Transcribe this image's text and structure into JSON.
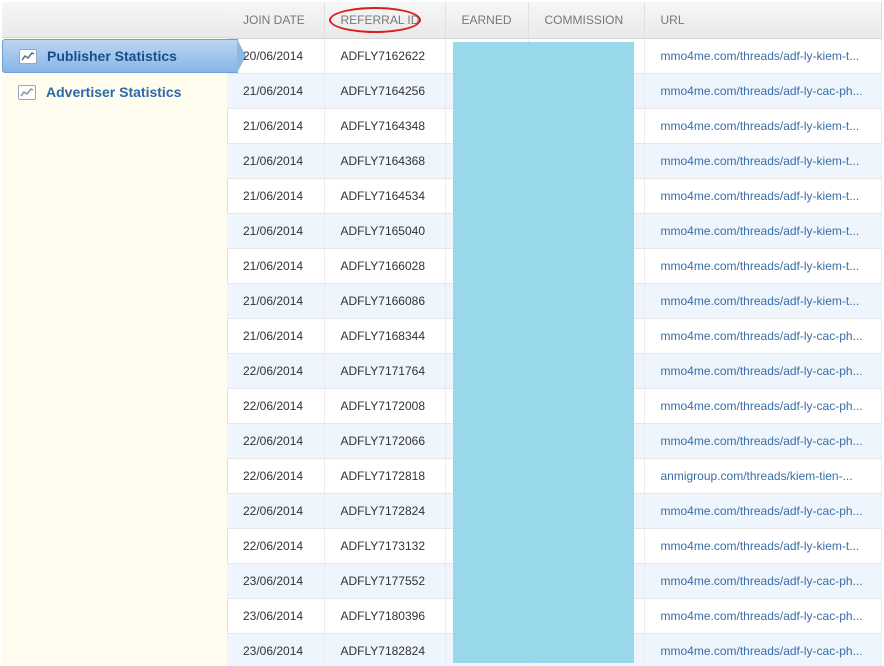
{
  "sidebar": {
    "items": [
      {
        "label": "Publisher Statistics",
        "icon": "chart-icon",
        "active": true
      },
      {
        "label": "Advertiser Statistics",
        "icon": "chart-icon",
        "active": false
      }
    ]
  },
  "table": {
    "headers": {
      "join_date": "JOIN DATE",
      "referral_id": "REFERRAL ID",
      "earned": "EARNED",
      "commission": "COMMISSION",
      "url": "URL"
    },
    "rows": [
      {
        "date": "20/06/2014",
        "id": "ADFLY7162622",
        "url": "mmo4me.com/threads/adf-ly-kiem-t..."
      },
      {
        "date": "21/06/2014",
        "id": "ADFLY7164256",
        "url": "mmo4me.com/threads/adf-ly-cac-ph..."
      },
      {
        "date": "21/06/2014",
        "id": "ADFLY7164348",
        "url": "mmo4me.com/threads/adf-ly-kiem-t..."
      },
      {
        "date": "21/06/2014",
        "id": "ADFLY7164368",
        "url": "mmo4me.com/threads/adf-ly-kiem-t..."
      },
      {
        "date": "21/06/2014",
        "id": "ADFLY7164534",
        "url": "mmo4me.com/threads/adf-ly-kiem-t..."
      },
      {
        "date": "21/06/2014",
        "id": "ADFLY7165040",
        "url": "mmo4me.com/threads/adf-ly-kiem-t..."
      },
      {
        "date": "21/06/2014",
        "id": "ADFLY7166028",
        "url": "mmo4me.com/threads/adf-ly-kiem-t..."
      },
      {
        "date": "21/06/2014",
        "id": "ADFLY7166086",
        "url": "mmo4me.com/threads/adf-ly-kiem-t..."
      },
      {
        "date": "21/06/2014",
        "id": "ADFLY7168344",
        "url": "mmo4me.com/threads/adf-ly-cac-ph..."
      },
      {
        "date": "22/06/2014",
        "id": "ADFLY7171764",
        "url": "mmo4me.com/threads/adf-ly-cac-ph..."
      },
      {
        "date": "22/06/2014",
        "id": "ADFLY7172008",
        "url": "mmo4me.com/threads/adf-ly-cac-ph..."
      },
      {
        "date": "22/06/2014",
        "id": "ADFLY7172066",
        "url": "mmo4me.com/threads/adf-ly-cac-ph..."
      },
      {
        "date": "22/06/2014",
        "id": "ADFLY7172818",
        "url": "anmigroup.com/threads/kiem-tien-..."
      },
      {
        "date": "22/06/2014",
        "id": "ADFLY7172824",
        "url": "mmo4me.com/threads/adf-ly-cac-ph..."
      },
      {
        "date": "22/06/2014",
        "id": "ADFLY7173132",
        "url": "mmo4me.com/threads/adf-ly-kiem-t..."
      },
      {
        "date": "23/06/2014",
        "id": "ADFLY7177552",
        "url": "mmo4me.com/threads/adf-ly-cac-ph..."
      },
      {
        "date": "23/06/2014",
        "id": "ADFLY7180396",
        "url": "mmo4me.com/threads/adf-ly-cac-ph..."
      },
      {
        "date": "23/06/2014",
        "id": "ADFLY7182824",
        "url": "mmo4me.com/threads/adf-ly-cac-ph..."
      }
    ]
  },
  "colors": {
    "accent_blue": "#2a6aa8",
    "active_nav": "#86b5e8",
    "redaction": "#99d8ea",
    "annotation_circle": "#d81e1e",
    "row_alt": "#eef5fc"
  }
}
